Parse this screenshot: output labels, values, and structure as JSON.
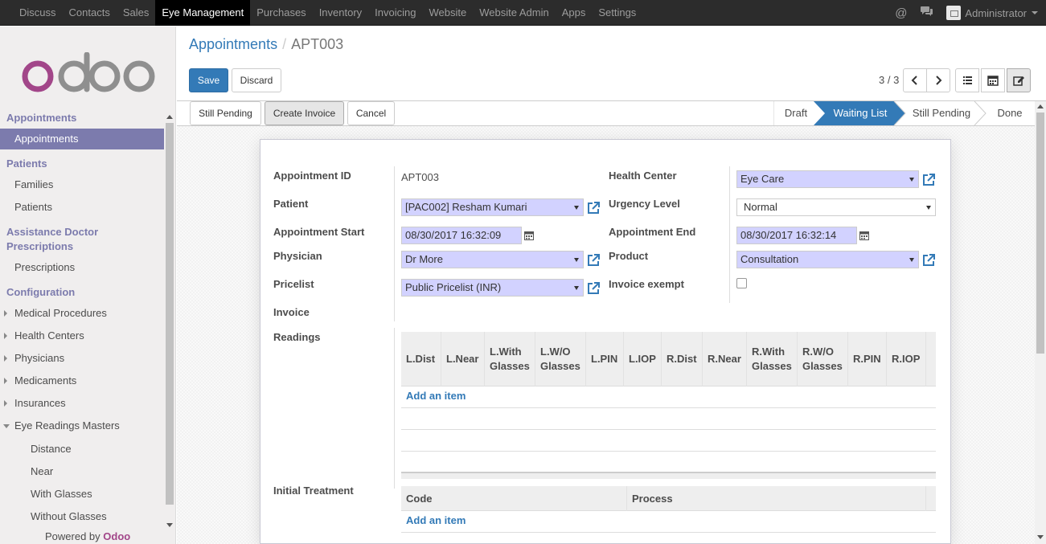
{
  "topbar": {
    "menu": [
      "Discuss",
      "Contacts",
      "Sales",
      "Eye Management",
      "Purchases",
      "Inventory",
      "Invoicing",
      "Website",
      "Website Admin",
      "Apps",
      "Settings"
    ],
    "active": "Eye Management",
    "user": "Administrator",
    "icons": [
      "at-icon",
      "chat-icon"
    ]
  },
  "sidebar": {
    "logo": "odoo",
    "sections": {
      "appointments": "Appointments",
      "patients": "Patients",
      "assistance": "Assistance Doctor Prescriptions",
      "configuration": "Configuration"
    },
    "items": {
      "appointments": "Appointments",
      "families": "Families",
      "patients": "Patients",
      "prescriptions": "Prescriptions",
      "medical_procedures": "Medical Procedures",
      "health_centers": "Health Centers",
      "physicians": "Physicians",
      "medicaments": "Medicaments",
      "insurances": "Insurances",
      "eye_readings_masters": "Eye Readings Masters",
      "distance": "Distance",
      "near": "Near",
      "with_glasses": "With Glasses",
      "without_glasses": "Without Glasses"
    },
    "powered_by": "Powered by",
    "powered_brand": "Odoo"
  },
  "control": {
    "breadcrumb_parent": "Appointments",
    "breadcrumb_current": "APT003",
    "save": "Save",
    "discard": "Discard",
    "pager": "3 / 3"
  },
  "statusbar": {
    "buttons": {
      "still_pending": "Still Pending",
      "create_invoice": "Create Invoice",
      "cancel": "Cancel"
    },
    "stages": [
      "Draft",
      "Waiting List",
      "Still Pending",
      "Done"
    ],
    "current_stage": "Waiting List",
    "current_color": "#337ab7"
  },
  "form": {
    "labels": {
      "appointment_id": "Appointment ID",
      "patient": "Patient",
      "appointment_start": "Appointment Start",
      "physician": "Physician",
      "pricelist": "Pricelist",
      "invoice": "Invoice",
      "health_center": "Health Center",
      "urgency_level": "Urgency Level",
      "appointment_end": "Appointment End",
      "product": "Product",
      "invoice_exempt": "Invoice exempt",
      "readings": "Readings",
      "initial_treatment": "Initial Treatment"
    },
    "values": {
      "appointment_id": "APT003",
      "patient": "[PAC002] Resham Kumari",
      "appointment_start": "08/30/2017 16:32:09",
      "physician": "Dr More",
      "pricelist": "Public Pricelist (INR)",
      "health_center": "Eye Care",
      "urgency_level": "Normal",
      "appointment_end": "08/30/2017 16:32:14",
      "product": "Consultation",
      "invoice_exempt": false
    },
    "readings_columns": [
      "L.Dist",
      "L.Near",
      "L.With Glasses",
      "L.W/O Glasses",
      "L.PIN",
      "L.IOP",
      "R.Dist",
      "R.Near",
      "R.With Glasses",
      "R.W/O Glasses",
      "R.PIN",
      "R.IOP"
    ],
    "treatment_columns": [
      "Code",
      "Process"
    ],
    "add_item": "Add an item",
    "add_item_2": "Add an item"
  }
}
